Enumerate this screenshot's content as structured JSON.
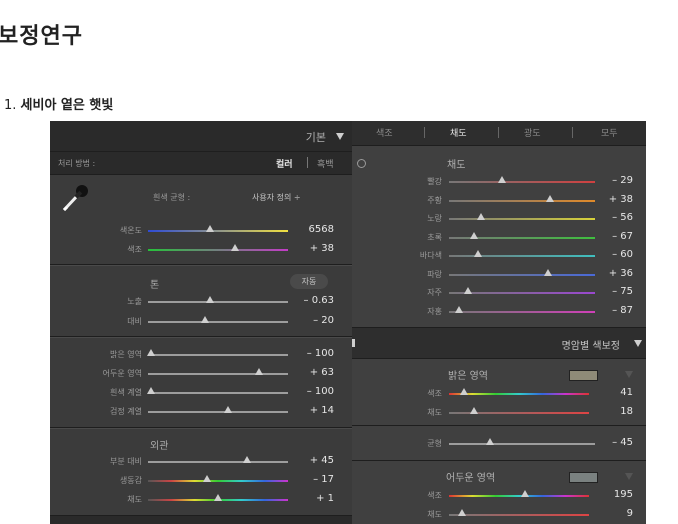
{
  "page": {
    "title": "보정연구",
    "step_number": "1.",
    "step_title": "세비아 옅은 햇빛"
  },
  "left_panel": {
    "header_label": "기본",
    "treatment_label": "처리 방법 :",
    "treatment_options": [
      "컬러",
      "흑백"
    ],
    "wb_label": "흰색 균형 :",
    "wb_value": "사용자 정의 ÷",
    "wb_sliders": [
      {
        "label": "색온도",
        "value": "6568",
        "pos": 0.44,
        "grad": "linear-gradient(90deg,#2e4bd6,#f0e040)"
      },
      {
        "label": "색조",
        "value": "+ 38",
        "pos": 0.62,
        "grad": "linear-gradient(90deg,#26c13a,#c23cc6)"
      }
    ],
    "tone_label": "톤",
    "auto_label": "자동",
    "tone_sliders": [
      {
        "label": "노출",
        "value": "– 0.63",
        "pos": 0.44
      },
      {
        "label": "대비",
        "value": "– 20",
        "pos": 0.41
      }
    ],
    "region_sliders": [
      {
        "label": "밝은 영역",
        "value": "– 100",
        "pos": 0.02
      },
      {
        "label": "어두운 영역",
        "value": "+ 63",
        "pos": 0.79
      },
      {
        "label": "흰색 계열",
        "value": "– 100",
        "pos": 0.02
      },
      {
        "label": "검정 계열",
        "value": "+ 14",
        "pos": 0.57
      }
    ],
    "presence_label": "외관",
    "presence_sliders": [
      {
        "label": "부분 대비",
        "value": "+ 45",
        "pos": 0.71
      },
      {
        "label": "생동감",
        "value": "– 17",
        "pos": 0.42,
        "grad": "linear-gradient(90deg,#555,#c44,#dd3,#3c3,#3cc,#36d,#c3c)"
      },
      {
        "label": "채도",
        "value": "+ 1",
        "pos": 0.5,
        "grad": "linear-gradient(90deg,#555,#c44,#dd3,#3c3,#3cc,#36d,#c3c)"
      }
    ]
  },
  "right_panel": {
    "tabs": [
      "색조",
      "채도",
      "광도",
      "모두"
    ],
    "active_tab": 1,
    "section_label": "채도",
    "sat_sliders": [
      {
        "label": "빨강",
        "value": "– 29",
        "pos": 0.36,
        "color": "#d04040"
      },
      {
        "label": "주황",
        "value": "+ 38",
        "pos": 0.69,
        "color": "#e08a2a"
      },
      {
        "label": "노랑",
        "value": "– 56",
        "pos": 0.22,
        "color": "#d8d23a"
      },
      {
        "label": "초록",
        "value": "– 67",
        "pos": 0.17,
        "color": "#3fbf3f"
      },
      {
        "label": "바다색",
        "value": "– 60",
        "pos": 0.2,
        "color": "#3fbfbf"
      },
      {
        "label": "파랑",
        "value": "+ 36",
        "pos": 0.68,
        "color": "#4a6ad8"
      },
      {
        "label": "자주",
        "value": "– 75",
        "pos": 0.13,
        "color": "#9a48d0"
      },
      {
        "label": "자홍",
        "value": "– 87",
        "pos": 0.07,
        "color": "#d040b8"
      }
    ],
    "split_header": "명암별 색보정",
    "highlights_label": "밝은 영역",
    "highlights_swatch": "#8f8b78",
    "highlights_sliders": [
      {
        "label": "색조",
        "value": "41",
        "pos": 0.11
      },
      {
        "label": "채도",
        "value": "18",
        "pos": 0.18
      }
    ],
    "balance_label": "균형",
    "balance_value": "– 45",
    "balance_pos": 0.28,
    "shadows_label": "어두운 영역",
    "shadows_swatch": "#7a8180",
    "shadows_sliders": [
      {
        "label": "색조",
        "value": "195",
        "pos": 0.54
      },
      {
        "label": "채도",
        "value": "9",
        "pos": 0.09
      }
    ]
  }
}
